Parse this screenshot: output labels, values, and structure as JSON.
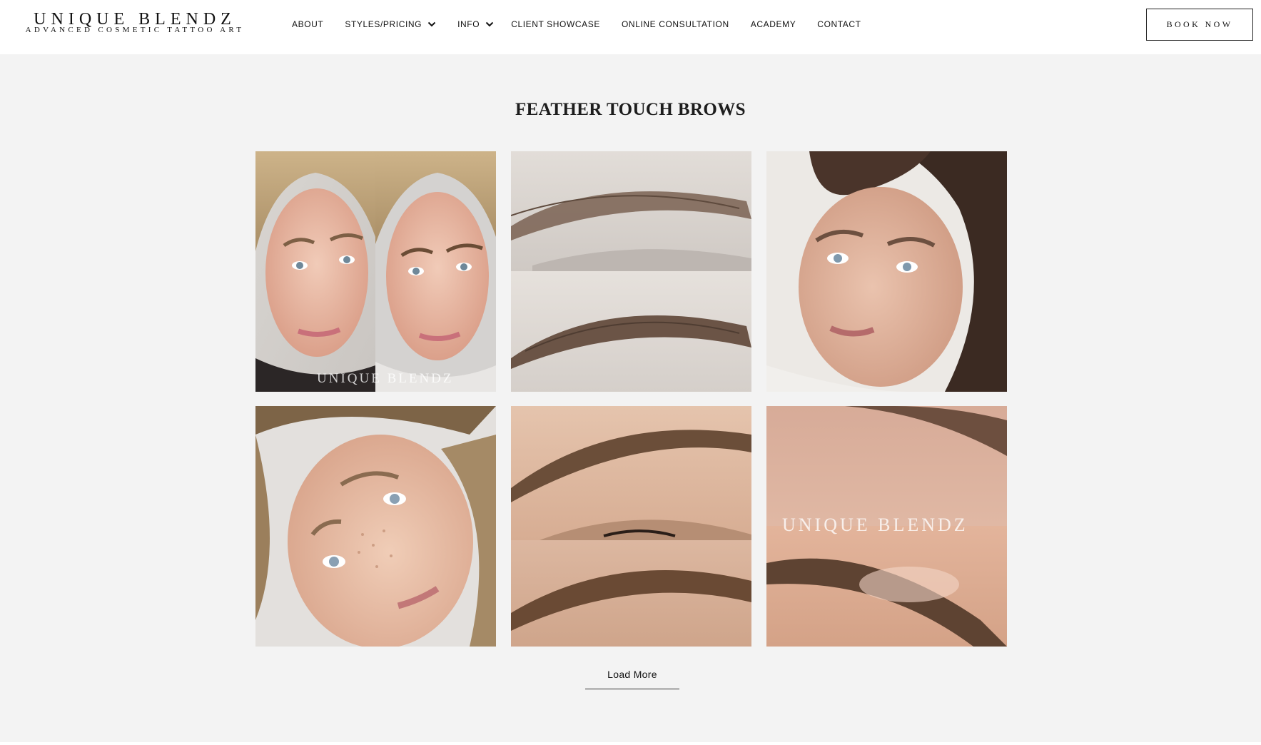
{
  "brand": {
    "name": "UNIQUE BLENDZ",
    "tagline": "ADVANCED COSMETIC TATTOO ART"
  },
  "nav": {
    "items": [
      {
        "label": "ABOUT",
        "icon": null
      },
      {
        "label": "STYLES/PRICING",
        "icon": "chevron-down-icon"
      },
      {
        "label": "INFO",
        "icon": "chevron-down-icon"
      },
      {
        "label": "CLIENT SHOWCASE",
        "icon": null
      },
      {
        "label": "ONLINE CONSULTATION",
        "icon": null
      },
      {
        "label": "ACADEMY",
        "icon": null
      },
      {
        "label": "CONTACT",
        "icon": null
      }
    ]
  },
  "header": {
    "book_label": "BOOK NOW"
  },
  "gallery": {
    "title": "FEATHER TOUCH BROWS",
    "watermarks": [
      "UNIQUE BLENDZ",
      "UNIQUE BLENDZ"
    ],
    "load_more_label": "Load More"
  },
  "colors": {
    "page_background": "#f3f3f3",
    "header_background": "#ffffff",
    "text": "#111111"
  }
}
